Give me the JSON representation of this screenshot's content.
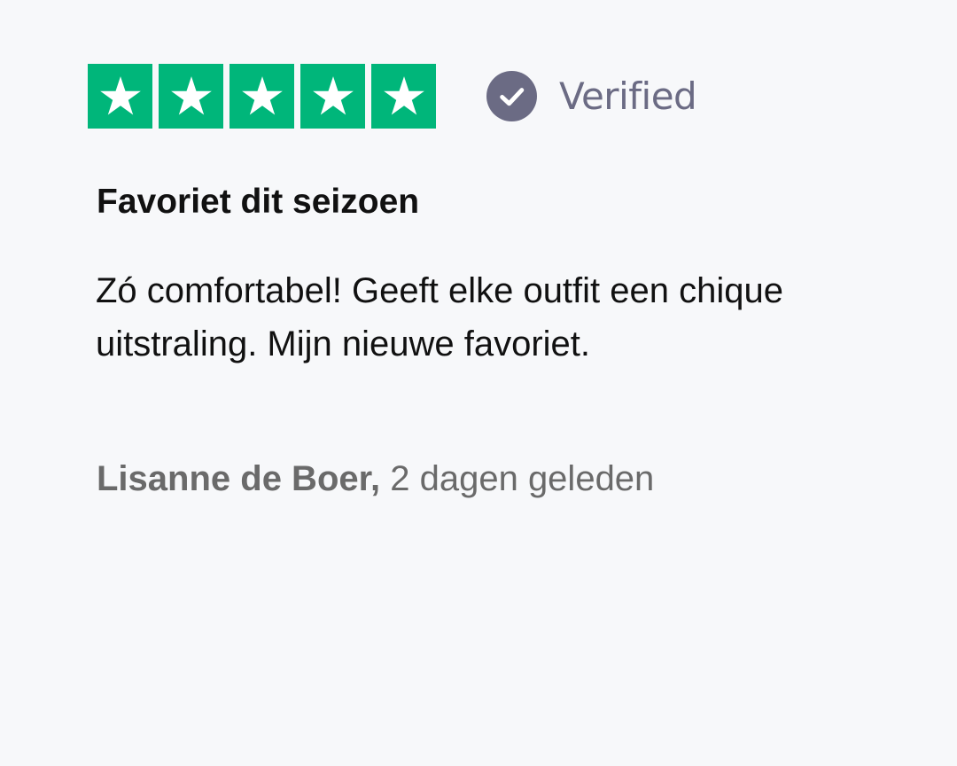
{
  "rating": {
    "value": 5,
    "max": 5,
    "star_color": "#00b67a",
    "star_icon": "star-icon"
  },
  "verified": {
    "label": "Verified",
    "icon": "check-circle-icon",
    "color": "#6b6b84"
  },
  "review": {
    "title": "Favoriet dit seizoen",
    "body": "Zó comfortabel! Geeft elke outfit een chique uitstraling. Mijn nieuwe favoriet.",
    "author": "Lisanne de Boer,",
    "date": "2 dagen geleden"
  }
}
